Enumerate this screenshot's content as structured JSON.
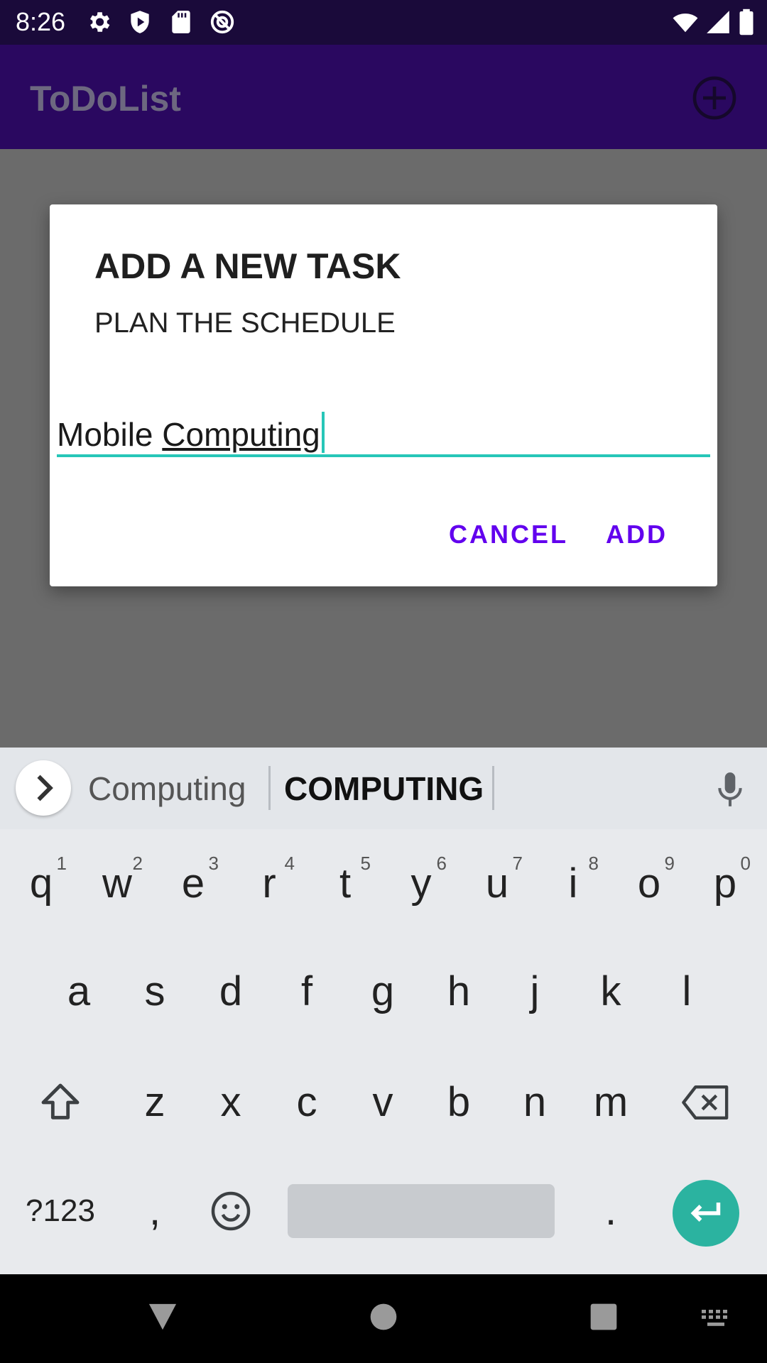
{
  "status_bar": {
    "time": "8:26",
    "icons": [
      "settings-icon",
      "shield-icon",
      "sd-card-icon",
      "vpn-icon",
      "wifi-icon",
      "signal-icon",
      "battery-icon"
    ]
  },
  "app_bar": {
    "title": "ToDoList",
    "add_icon": "add-circle-icon"
  },
  "dialog": {
    "title": "ADD A NEW TASK",
    "message": "PLAN THE SCHEDULE",
    "input": {
      "value_prefix": "Mobile ",
      "value_composing": "Computing"
    },
    "buttons": {
      "cancel": "CANCEL",
      "add": "ADD"
    },
    "accent_color": "#6200ee",
    "field_color": "#27c6b8"
  },
  "keyboard": {
    "suggestions": [
      "Computing",
      "COMPUTING"
    ],
    "row1": [
      {
        "k": "q",
        "n": "1"
      },
      {
        "k": "w",
        "n": "2"
      },
      {
        "k": "e",
        "n": "3"
      },
      {
        "k": "r",
        "n": "4"
      },
      {
        "k": "t",
        "n": "5"
      },
      {
        "k": "y",
        "n": "6"
      },
      {
        "k": "u",
        "n": "7"
      },
      {
        "k": "i",
        "n": "8"
      },
      {
        "k": "o",
        "n": "9"
      },
      {
        "k": "p",
        "n": "0"
      }
    ],
    "row2": [
      "a",
      "s",
      "d",
      "f",
      "g",
      "h",
      "j",
      "k",
      "l"
    ],
    "row3": [
      "z",
      "x",
      "c",
      "v",
      "b",
      "n",
      "m"
    ],
    "row4": {
      "symbols": "?123",
      "comma": ",",
      "period": "."
    },
    "enter_color": "#2bb3a0"
  },
  "nav_bar": {
    "icons": [
      "back-icon",
      "home-icon",
      "recents-icon",
      "keyboard-switch-icon"
    ]
  }
}
